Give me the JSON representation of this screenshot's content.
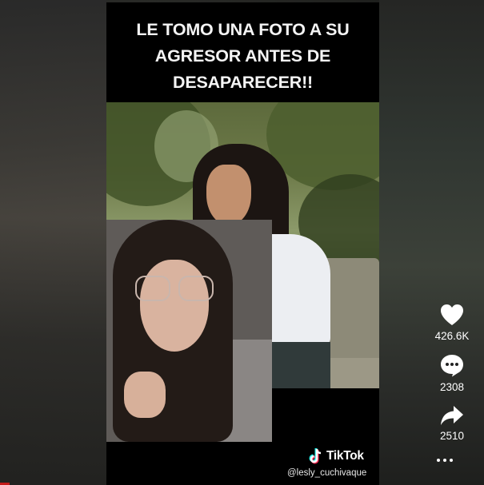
{
  "video": {
    "caption_lines": [
      "LE TOMO UNA FOTO A SU",
      "AGRESOR ANTES DE",
      "DESAPARECER!!"
    ],
    "watermark": {
      "brand": "TikTok",
      "handle": "@lesly_cuchivaque"
    }
  },
  "actions": {
    "likes": "426.6K",
    "comments": "2308",
    "shares": "2510"
  },
  "icons": [
    "heart-icon",
    "comment-icon",
    "share-icon",
    "more-icon",
    "tiktok-logo-icon"
  ],
  "colors": {
    "accent_red": "#c41a1a",
    "text": "#ffffff",
    "background": "#000000"
  }
}
